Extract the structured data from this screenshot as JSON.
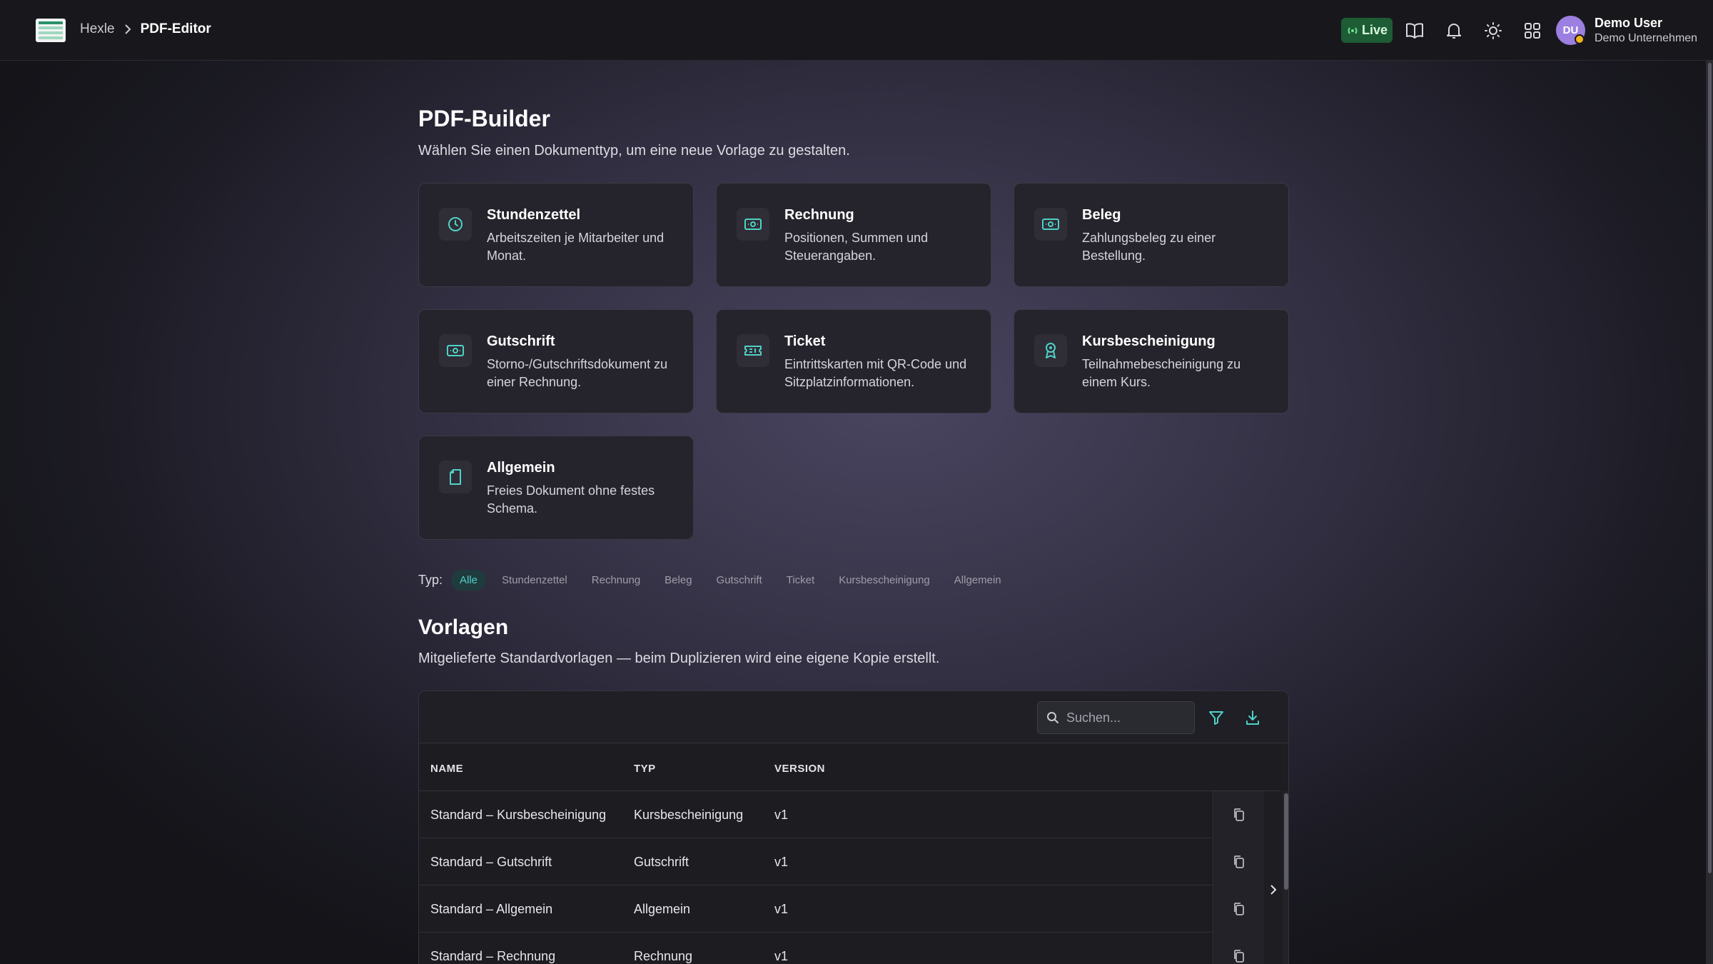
{
  "breadcrumb": {
    "root": "Hexle",
    "current": "PDF-Editor"
  },
  "topbar": {
    "live_label": "Live",
    "icons": [
      "book-icon",
      "bell-icon",
      "sun-icon",
      "grid-icon"
    ],
    "user": {
      "initials": "DU",
      "name": "Demo User",
      "org": "Demo Unternehmen"
    }
  },
  "builder": {
    "title": "PDF-Builder",
    "subtitle": "Wählen Sie einen Dokumenttyp, um eine neue Vorlage zu gestalten.",
    "cards": [
      {
        "title": "Stundenzettel",
        "desc": "Arbeitszeiten je Mitarbeiter und Monat.",
        "icon": "clock-icon"
      },
      {
        "title": "Rechnung",
        "desc": "Positionen, Summen und Steuerangaben.",
        "icon": "banknote-icon"
      },
      {
        "title": "Beleg",
        "desc": "Zahlungsbeleg zu einer Bestellung.",
        "icon": "banknote-icon"
      },
      {
        "title": "Gutschrift",
        "desc": "Storno-/Gutschriftsdokument zu einer Rechnung.",
        "icon": "banknote-icon"
      },
      {
        "title": "Ticket",
        "desc": "Eintrittskarten mit QR-Code und Sitzplatzinformationen.",
        "icon": "ticket-icon"
      },
      {
        "title": "Kursbescheinigung",
        "desc": "Teilnahmebescheinigung zu einem Kurs.",
        "icon": "award-icon"
      },
      {
        "title": "Allgemein",
        "desc": "Freies Dokument ohne festes Schema.",
        "icon": "file-icon"
      }
    ]
  },
  "filter": {
    "label": "Typ:",
    "options": [
      "Alle",
      "Stundenzettel",
      "Rechnung",
      "Beleg",
      "Gutschrift",
      "Ticket",
      "Kursbescheinigung",
      "Allgemein"
    ],
    "active": "Alle"
  },
  "templates": {
    "title": "Vorlagen",
    "subtitle": "Mitgelieferte Standardvorlagen — beim Duplizieren wird eine eigene Kopie erstellt.",
    "search_placeholder": "Suchen...",
    "columns": [
      "NAME",
      "TYP",
      "VERSION"
    ],
    "rows": [
      {
        "name": "Standard – Kursbescheinigung",
        "type": "Kursbescheinigung",
        "version": "v1"
      },
      {
        "name": "Standard – Gutschrift",
        "type": "Gutschrift",
        "version": "v1"
      },
      {
        "name": "Standard – Allgemein",
        "type": "Allgemein",
        "version": "v1"
      },
      {
        "name": "Standard – Rechnung",
        "type": "Rechnung",
        "version": "v1"
      }
    ]
  },
  "colors": {
    "accent": "#4fd1c5",
    "live_bg": "#1d5c34",
    "avatar": "#9c7fe0",
    "status_dot": "#f2b51c"
  }
}
